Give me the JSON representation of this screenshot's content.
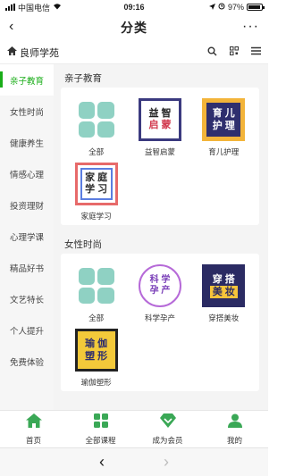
{
  "status": {
    "carrier": "中国电信",
    "time": "09:16",
    "battery_percent": "97%"
  },
  "header": {
    "back_icon": "‹",
    "title": "分类",
    "more_icon": "···"
  },
  "nav": {
    "home_icon": "home-icon",
    "brand": "良师学苑"
  },
  "sidebar": {
    "items": [
      {
        "label": "亲子教育",
        "active": true
      },
      {
        "label": "女性时尚"
      },
      {
        "label": "健康养生"
      },
      {
        "label": "情感心理"
      },
      {
        "label": "投资理财"
      },
      {
        "label": "心理学课"
      },
      {
        "label": "精品好书"
      },
      {
        "label": "文艺特长"
      },
      {
        "label": "个人提升"
      },
      {
        "label": "免费体验"
      }
    ]
  },
  "sections": [
    {
      "title": "亲子教育",
      "items": [
        {
          "label": "全部",
          "thumb": "grid-icon"
        },
        {
          "label": "益智启蒙",
          "thumb_text": [
            "益 智",
            "启 蒙"
          ]
        },
        {
          "label": "育儿护理",
          "thumb_text": [
            "育 儿",
            "护 理"
          ]
        },
        {
          "label": "家庭学习",
          "thumb_text": [
            "家 庭",
            "学 习"
          ]
        }
      ]
    },
    {
      "title": "女性时尚",
      "items": [
        {
          "label": "全部",
          "thumb": "grid-icon"
        },
        {
          "label": "科学孕产",
          "thumb_text": [
            "科 学",
            "孕 产"
          ]
        },
        {
          "label": "穿搭美妆",
          "thumb_text": [
            "穿 搭",
            "美 妆"
          ]
        },
        {
          "label": "瑜伽塑形",
          "thumb_text": [
            "瑜 伽",
            "塑 形"
          ]
        }
      ]
    }
  ],
  "tabs": [
    {
      "label": "首页"
    },
    {
      "label": "全部课程"
    },
    {
      "label": "成为会员"
    },
    {
      "label": "我的"
    }
  ],
  "browser": {
    "back": "‹",
    "forward": "›"
  },
  "colors": {
    "accent": "#1aad19",
    "tab_icon": "#3aa856"
  }
}
